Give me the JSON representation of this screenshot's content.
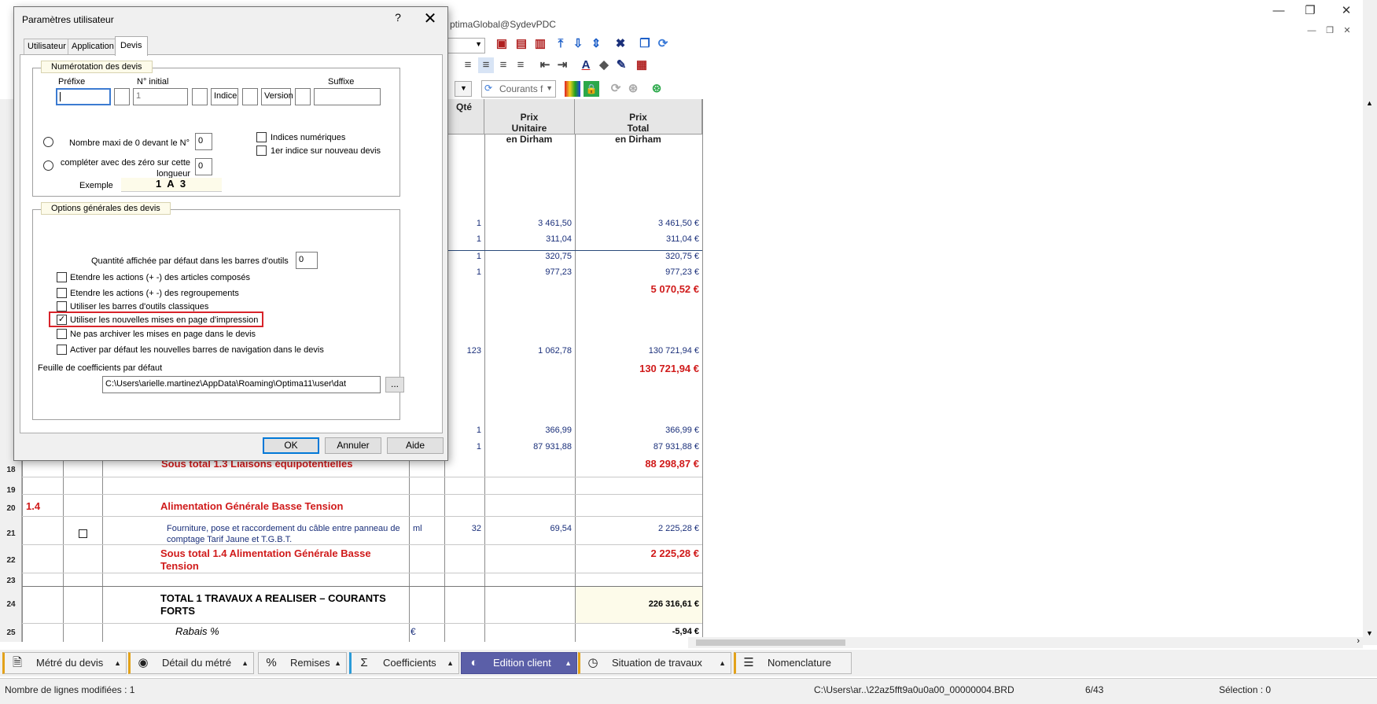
{
  "app": {
    "title_fragment": "ptimaGlobal@SydevPDC",
    "win_minimize": "—",
    "win_restore": "❐",
    "win_close": "✕",
    "mdi_minimize": "—",
    "mdi_restore": "❐",
    "mdi_close": "✕"
  },
  "toolbar": {
    "filter_value": "Courants f",
    "icons": [
      "save-icon",
      "cut-icon",
      "paste-icon",
      "move-top-icon",
      "move-down-icon",
      "move-up-down-icon",
      "tools-icon",
      "window-copy-icon",
      "link-icon",
      "align-left-icon",
      "align-center-icon",
      "align-right-icon",
      "indent-decrease-icon",
      "indent-increase-icon",
      "font-color-icon",
      "fill-color-icon",
      "brush-icon",
      "delete-format-icon",
      "color-grid-icon",
      "lock-icon",
      "sync-icon",
      "refresh-icon",
      "green-refresh-icon"
    ]
  },
  "table": {
    "headers": {
      "qte": "Qté",
      "pu": "Prix\nUnitaire\nen Dirham",
      "pt": "Prix\nTotal\nen Dirham"
    },
    "rows": [
      {
        "qte": "1",
        "pu": "3 461,50",
        "pt": "3 461,50 €"
      },
      {
        "qte": "1",
        "pu": "311,04",
        "pt": "311,04 €"
      },
      {
        "qte": "1",
        "pu": "320,75",
        "pt": "320,75 €"
      },
      {
        "qte": "1",
        "pu": "977,23",
        "pt": "977,23 €"
      },
      {
        "subtotal": "5 070,52 €"
      },
      {
        "qte": "123",
        "pu": "1 062,78",
        "pt": "130 721,94 €"
      },
      {
        "subtotal": "130 721,94 €"
      },
      {
        "qte": "1",
        "pu": "366,99",
        "pt": "366,99 €"
      },
      {
        "qte": "1",
        "pu": "87 931,88",
        "pt": "87 931,88 €"
      }
    ],
    "row18": {
      "num": "18",
      "label": "Sous total 1.3 Liaisons équipotentielles",
      "pt": "88 298,87 €"
    },
    "row19": {
      "num": "19"
    },
    "row20": {
      "num": "20",
      "code": "1.4",
      "label": "Alimentation Générale Basse Tension"
    },
    "row21": {
      "num": "21",
      "label": "Fourniture, pose et raccordement du câble entre panneau de comptage Tarif Jaune et T.G.B.T.",
      "unit": "ml",
      "qte": "32",
      "pu": "69,54",
      "pt": "2 225,28 €"
    },
    "row22": {
      "num": "22",
      "label": "Sous total 1.4 Alimentation Générale Basse Tension",
      "pt": "2 225,28 €"
    },
    "row23": {
      "num": "23"
    },
    "row24": {
      "num": "24",
      "label": "TOTAL 1 TRAVAUX A REALISER – COURANTS FORTS",
      "pt": "226 316,61 €"
    },
    "row25": {
      "num": "25",
      "label": "Rabais %",
      "unit": "€",
      "pt": "-5,94 €"
    }
  },
  "bottom_tabs": [
    {
      "label": "Métré du devis",
      "icon": "document-icon"
    },
    {
      "label": "Détail du métré",
      "icon": "eye-icon"
    },
    {
      "label": "Remises",
      "icon": "percent-icon"
    },
    {
      "label": "Coefficients",
      "icon": "sigma-icon"
    },
    {
      "label": "Edition client",
      "icon": "person-icon"
    },
    {
      "label": "Situation de travaux",
      "icon": "clock-icon"
    },
    {
      "label": "Nomenclature",
      "icon": "list-icon"
    }
  ],
  "status": {
    "modified": "Nombre de lignes modifiées : 1",
    "file": "C:\\Users\\ar..\\22az5fft9a0u0a00_00000004.BRD",
    "page": "6/43",
    "selection": "Sélection : 0"
  },
  "dialog": {
    "title": "Paramètres utilisateur",
    "help": "?",
    "close": "✕",
    "tabs": [
      "Utilisateur",
      "Application",
      "Devis"
    ],
    "numbering": {
      "legend": "Numérotation des devis",
      "prefix_label": "Préfixe",
      "initial_label": "N° initial",
      "suffix_label": "Suffixe",
      "initial_value": "1",
      "indice_value": "Indice",
      "version_value": "Version",
      "radio1": "Nombre maxi de 0 devant le N°",
      "radio1_value": "0",
      "radio2": "compléter avec des zéro sur cette longueur",
      "radio2_value": "0",
      "chk_indices": "Indices numériques",
      "chk_first": "1er indice sur nouveau devis",
      "example_label": "Exemple",
      "example_value": "1 A 3"
    },
    "options": {
      "legend": "Options générales des devis",
      "qty_label": "Quantité affichée par défaut dans les barres d'outils",
      "qty_value": "0",
      "chk1": "Etendre les actions (+ -) des articles composés",
      "chk2": "Etendre les actions (+ -) des regroupements",
      "chk3": "Utiliser les barres d'outils classiques",
      "chk4": "Utiliser les nouvelles mises en page d'impression",
      "chk4_mark": "✓",
      "chk5": "Ne pas archiver les mises en page dans le devis",
      "chk6": "Activer par défaut les nouvelles barres de navigation dans le devis",
      "sheet_label": "Feuille de coefficients par défaut",
      "sheet_value": "C:\\Users\\arielle.martinez\\AppData\\Roaming\\Optima11\\user\\dat",
      "browse": "..."
    },
    "buttons": {
      "ok": "OK",
      "cancel": "Annuler",
      "help": "Aide"
    }
  }
}
